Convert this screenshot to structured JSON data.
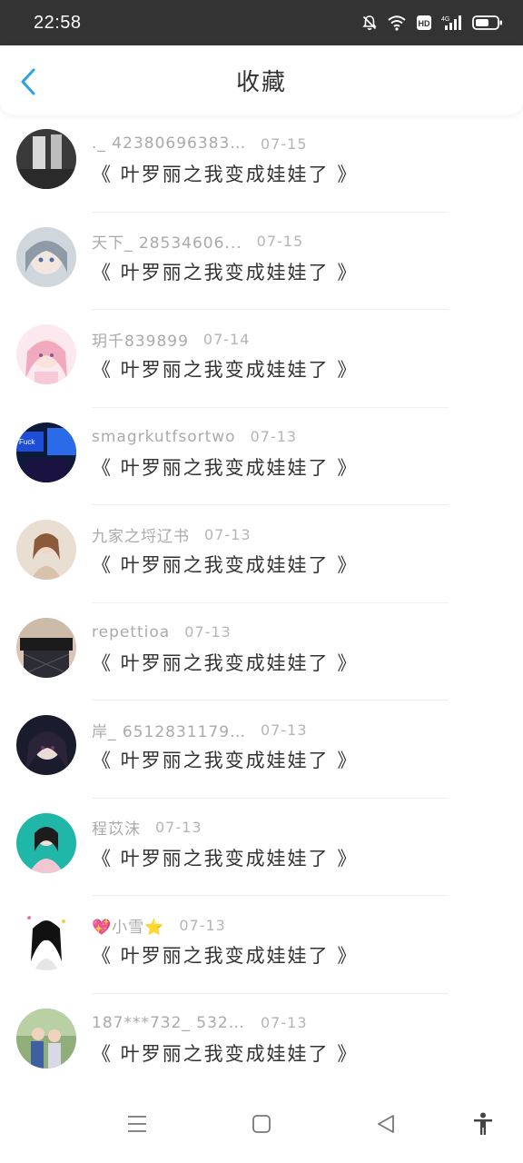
{
  "status_bar": {
    "time": "22:58"
  },
  "header": {
    "title": "收藏"
  },
  "items": [
    {
      "user": "._ 423806963837...",
      "date": "07-15",
      "title": "《 叶罗丽之我变成娃娃了 》"
    },
    {
      "user": "天下_ 28534606...",
      "date": "07-15",
      "title": "《 叶罗丽之我变成娃娃了 》"
    },
    {
      "user": "玥千839899",
      "date": "07-14",
      "title": "《 叶罗丽之我变成娃娃了 》"
    },
    {
      "user": "smagrkutfsortwo",
      "date": "07-13",
      "title": "《 叶罗丽之我变成娃娃了 》"
    },
    {
      "user": "九家之埒辽书",
      "date": "07-13",
      "title": "《 叶罗丽之我变成娃娃了 》"
    },
    {
      "user": "repettioa",
      "date": "07-13",
      "title": "《 叶罗丽之我变成娃娃了 》"
    },
    {
      "user": "岸_ 6512831179...",
      "date": "07-13",
      "title": "《 叶罗丽之我变成娃娃了 》"
    },
    {
      "user": "程苡沫",
      "date": "07-13",
      "title": "《 叶罗丽之我变成娃娃了 》"
    },
    {
      "user": "💖小雪⭐",
      "date": "07-13",
      "title": "《 叶罗丽之我变成娃娃了 》"
    },
    {
      "user": "187***732_ 5325...",
      "date": "07-13",
      "title": "《 叶罗丽之我变成娃娃了 》"
    }
  ],
  "colors": {
    "accent": "#2ba3e6",
    "status_bar": "#333333"
  },
  "icons": {
    "back": "chevron-left-icon",
    "status": [
      "bell-off-icon",
      "wifi-icon",
      "hd-icon",
      "signal-4g-icon",
      "battery-icon"
    ],
    "nav": [
      "menu-icon",
      "home-square-icon",
      "back-triangle-icon",
      "accessibility-icon"
    ]
  }
}
